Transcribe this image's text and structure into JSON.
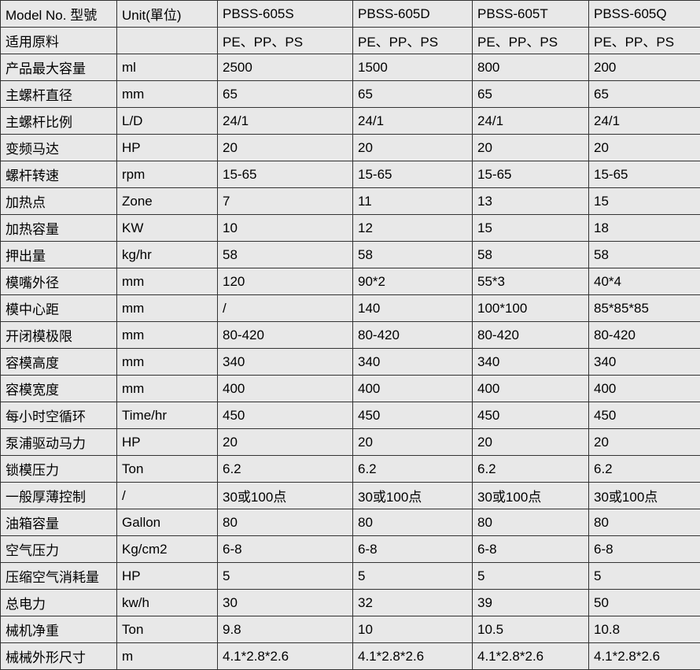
{
  "header": [
    "Model No. 型號",
    "Unit(單位)",
    "PBSS-605S",
    "PBSS-605D",
    "PBSS-605T",
    "PBSS-605Q"
  ],
  "rows": [
    [
      "适用原料",
      "",
      "PE、PP、PS",
      "PE、PP、PS",
      "PE、PP、PS",
      "PE、PP、PS"
    ],
    [
      "产品最大容量",
      "ml",
      "2500",
      "1500",
      "800",
      "200"
    ],
    [
      "主螺杆直径",
      "mm",
      "65",
      "65",
      "65",
      "65"
    ],
    [
      "主螺杆比例",
      "L/D",
      "24/1",
      "24/1",
      "24/1",
      "24/1"
    ],
    [
      "变频马达",
      "HP",
      "20",
      "20",
      "20",
      "20"
    ],
    [
      "螺杆转速",
      "rpm",
      "15-65",
      "15-65",
      "15-65",
      "15-65"
    ],
    [
      "加热点",
      "Zone",
      "7",
      "11",
      "13",
      "15"
    ],
    [
      "加热容量",
      "KW",
      "10",
      "12",
      "15",
      "18"
    ],
    [
      "押出量",
      "kg/hr",
      "58",
      "58",
      "58",
      "58"
    ],
    [
      "模嘴外径",
      "mm",
      "120",
      "90*2",
      "55*3",
      "40*4"
    ],
    [
      "模中心距",
      "mm",
      "/",
      "140",
      "100*100",
      "85*85*85"
    ],
    [
      "开闭模极限",
      "mm",
      "80-420",
      "80-420",
      "80-420",
      "80-420"
    ],
    [
      "容模高度",
      "mm",
      "340",
      "340",
      "340",
      "340"
    ],
    [
      "容模宽度",
      "mm",
      "400",
      "400",
      "400",
      "400"
    ],
    [
      "每小时空循环",
      "Time/hr",
      "450",
      "450",
      "450",
      "450"
    ],
    [
      "泵浦驱动马力",
      "HP",
      "20",
      "20",
      "20",
      "20"
    ],
    [
      "锁模压力",
      "Ton",
      "6.2",
      "6.2",
      "6.2",
      "6.2"
    ],
    [
      "一般厚薄控制",
      "/",
      "30或100点",
      "30或100点",
      "30或100点",
      "30或100点"
    ],
    [
      "油箱容量",
      "Gallon",
      "80",
      "80",
      "80",
      "80"
    ],
    [
      "空气压力",
      "Kg/cm2",
      "6-8",
      "6-8",
      "6-8",
      "6-8"
    ],
    [
      "压缩空气消耗量",
      "HP",
      "5",
      "5",
      "5",
      "5"
    ],
    [
      "总电力",
      "kw/h",
      "30",
      "32",
      "39",
      "50"
    ],
    [
      "械机净重",
      "Ton",
      "9.8",
      "10",
      "10.5",
      "10.8"
    ],
    [
      "械械外形尺寸",
      "m",
      "4.1*2.8*2.6",
      "4.1*2.8*2.6",
      "4.1*2.8*2.6",
      "4.1*2.8*2.6"
    ]
  ]
}
